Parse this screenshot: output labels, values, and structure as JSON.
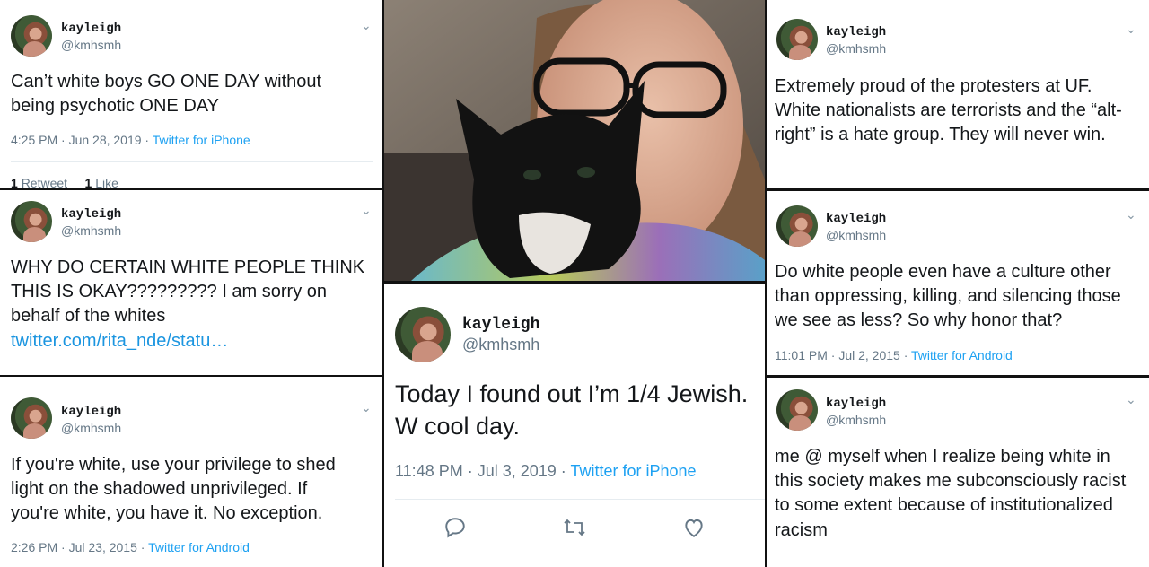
{
  "user": {
    "name": "kayleigh",
    "handle": "@kmhsmh"
  },
  "tweets": [
    {
      "text": "Can’t white boys GO ONE DAY without being psychotic ONE DAY",
      "time": "4:25 PM · Jun 28, 2019 · ",
      "source": "Twitter for iPhone",
      "retweets": "1",
      "retweets_label": "Retweet",
      "likes": "1",
      "likes_label": "Like"
    },
    {
      "text": "WHY DO CERTAIN WHITE PEOPLE THINK THIS IS OKAY????????? I am sorry on behalf of the whites",
      "link": "twitter.com/rita_nde/statu…"
    },
    {
      "text": "If you're white, use your privilege to shed light on the shadowed unprivileged. If you're white, you have it. No exception.",
      "time": "2:26 PM · Jul 23, 2015 · ",
      "source": "Twitter for Android"
    },
    {
      "text": "Today I found out I’m 1/4 Jewish. W cool day.",
      "time": "11:48 PM · Jul 3, 2019 · ",
      "source": "Twitter for iPhone"
    },
    {
      "text": "Extremely proud of the protesters at UF. White nationalists are terrorists and the “alt-right” is a hate group. They will never win."
    },
    {
      "text": "Do white people even have a culture other than oppressing, killing, and silencing those we see as less? So why honor that?",
      "time": "11:01 PM · Jul 2, 2015 · ",
      "source": "Twitter for Android"
    },
    {
      "text": "me @ myself when I realize being white in this society makes me subconsciously racist to some extent because of institutionalized racism"
    }
  ],
  "photo": {
    "description": "selfie with black and white kitten"
  },
  "icons": [
    "chevron-down-icon",
    "reply-icon",
    "retweet-icon",
    "like-icon"
  ],
  "colors": {
    "link": "#1da1f2",
    "text": "#14171a",
    "muted": "#657786"
  }
}
